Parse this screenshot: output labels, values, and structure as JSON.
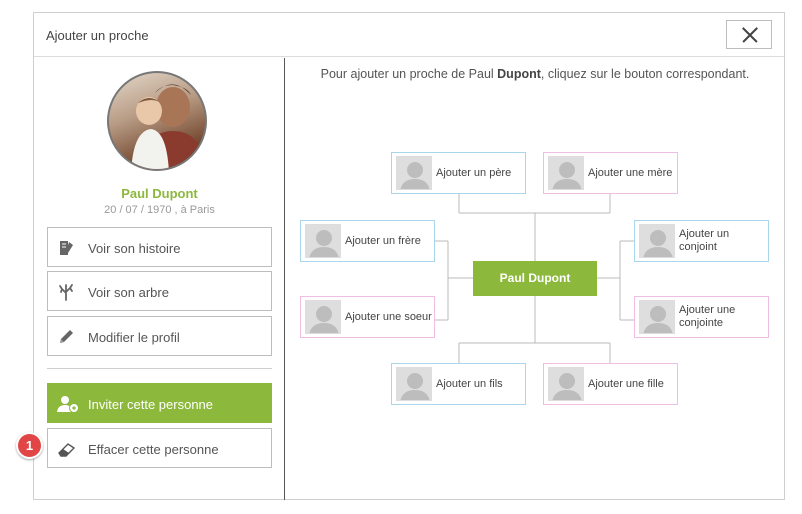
{
  "dialog": {
    "title": "Ajouter un proche"
  },
  "profile": {
    "name": "Paul Dupont",
    "dates": "20 / 07 / 1970 , à Paris"
  },
  "actions": {
    "story": "Voir son histoire",
    "tree": "Voir son arbre",
    "edit": "Modifier le profil",
    "invite": "Inviter cette personne",
    "erase": "Effacer cette personne"
  },
  "badge": {
    "number": "1"
  },
  "instruction": {
    "before": "Pour ajouter un proche de Paul ",
    "bold": "Dupont",
    "after": ", cliquez sur le bouton correspondant."
  },
  "relatives": {
    "pere": "Ajouter un père",
    "mere": "Ajouter une mère",
    "frere": "Ajouter un frère",
    "soeur": "Ajouter une soeur",
    "conjoint": "Ajouter un conjoint",
    "conjointe": "Ajouter une conjointe",
    "fils": "Ajouter un fils",
    "fille": "Ajouter une fille"
  },
  "center": {
    "name": "Paul Dupont"
  },
  "colors": {
    "accent": "#8cb83c",
    "male_border": "#a9d6ea",
    "female_border": "#eebfe2",
    "badge": "#e24545"
  }
}
